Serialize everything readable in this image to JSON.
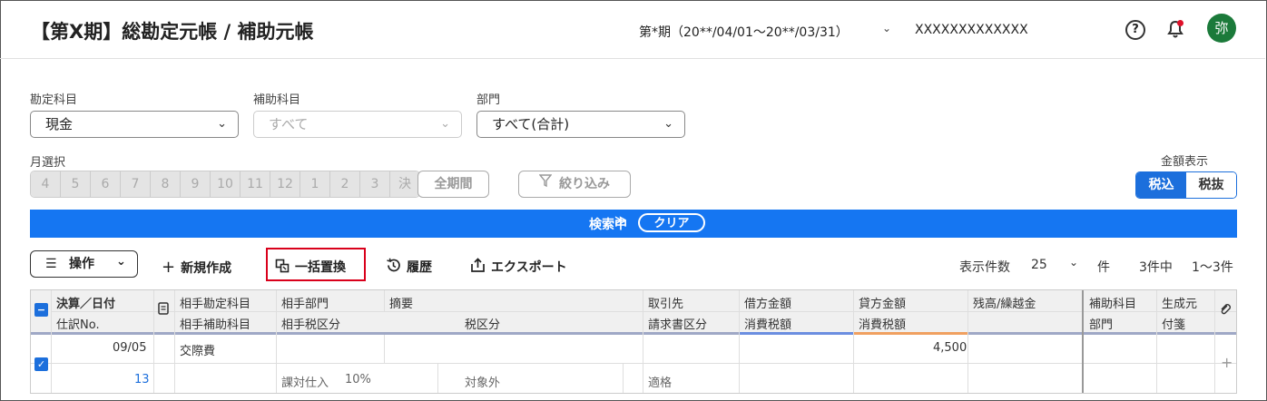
{
  "header": {
    "title": "【第X期】総勘定元帳 / 補助元帳",
    "period": "第*期（20**/04/01〜20**/03/31）",
    "company": "XXXXXXXXXXXXX",
    "avatar": "弥"
  },
  "filters": {
    "account_label": "勘定科目",
    "account_value": "現金",
    "sub_account_label": "補助科目",
    "sub_account_placeholder": "すべて",
    "department_label": "部門",
    "department_value": "すべて(合計)",
    "month_label": "月選択",
    "months": [
      "4",
      "5",
      "6",
      "7",
      "8",
      "9",
      "10",
      "11",
      "12",
      "1",
      "2",
      "3",
      "決"
    ],
    "all_period": "全期間",
    "narrow": "絞り込み",
    "amount_label": "金額表示",
    "tax_in": "税込",
    "tax_out": "税抜"
  },
  "search_bar": {
    "status": "検索中",
    "clear": "クリア"
  },
  "toolbar": {
    "operation": "操作",
    "new": "新規作成",
    "bulk_replace": "一括置換",
    "history": "履歴",
    "export": "エクスポート",
    "display_count_label": "表示件数",
    "display_count": "25",
    "count_unit": "件",
    "total": "3件中",
    "range": "1〜3件"
  },
  "table": {
    "headers_top": [
      "決算／日付",
      "相手勘定科目",
      "相手部門",
      "摘要",
      "取引先",
      "借方金額",
      "貸方金額",
      "残高/繰越金",
      "補助科目",
      "生成元"
    ],
    "headers_bottom": [
      "仕訳No.",
      "相手補助科目",
      "相手税区分",
      "税区分",
      "請求書区分",
      "消費税額",
      "消費税額",
      "部門",
      "付箋"
    ],
    "rows": [
      {
        "date": "09/05",
        "entry_no": "13",
        "counter_account": "交際費",
        "counter_tax": "課対仕入",
        "tax_rate": "10%",
        "tax_class": "対象外",
        "invoice": "適格",
        "credit": "4,500"
      }
    ]
  },
  "colors": {
    "accent": "#1576f2",
    "highlight": "#d9001b",
    "avatar": "#1b7a3a"
  }
}
